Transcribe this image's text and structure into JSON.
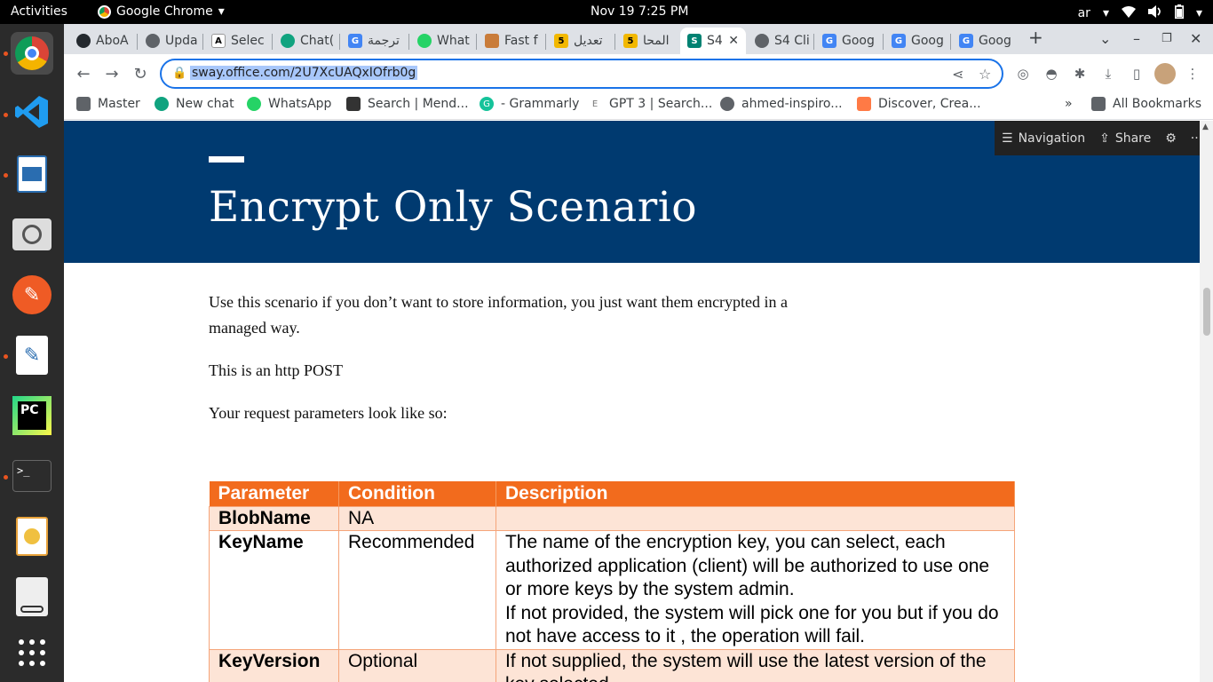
{
  "topbar": {
    "activities": "Activities",
    "app_name": "Google Chrome",
    "datetime": "Nov 19  7:25 PM",
    "lang": "ar",
    "tray_icons": [
      "wifi-icon",
      "volume-icon",
      "battery-icon",
      "power-menu-icon"
    ]
  },
  "dock": {
    "apps": [
      "chrome",
      "vscode",
      "impress",
      "image-viewer",
      "postman",
      "text-editor",
      "pycharm",
      "terminal",
      "draw",
      "document-viewer",
      "app-grid"
    ]
  },
  "tabs": [
    {
      "title": "AboA",
      "icon": "github-icon"
    },
    {
      "title": "Upda",
      "icon": "globe-icon"
    },
    {
      "title": "Selec",
      "icon": "a-icon"
    },
    {
      "title": "Chat(",
      "icon": "openai-icon"
    },
    {
      "title": "ترجمة",
      "icon": "translate-icon"
    },
    {
      "title": "What",
      "icon": "whatsapp-icon"
    },
    {
      "title": "Fast f",
      "icon": "market-icon"
    },
    {
      "title": "تعديل",
      "icon": "five-icon"
    },
    {
      "title": "المحا",
      "icon": "five-icon"
    },
    {
      "title": "S4",
      "icon": "sway-icon",
      "active": true
    },
    {
      "title": "S4 Cli",
      "icon": "globe-icon"
    },
    {
      "title": "Goog",
      "icon": "translate-icon"
    },
    {
      "title": "Goog",
      "icon": "translate-icon"
    },
    {
      "title": "Goog",
      "icon": "translate-icon"
    }
  ],
  "omnibox": {
    "url": "sway.office.com/2U7XcUAQxIOfrb0g"
  },
  "bookmarks": [
    {
      "label": "Master",
      "icon": "folder-icon"
    },
    {
      "label": "New chat",
      "icon": "openai-icon"
    },
    {
      "label": "WhatsApp",
      "icon": "whatsapp-icon"
    },
    {
      "label": "Search | Mend...",
      "icon": "mendeley-icon"
    },
    {
      "label": "- Grammarly",
      "icon": "grammarly-icon"
    },
    {
      "label": "GPT 3 | Search...",
      "icon": "e-icon"
    },
    {
      "label": "ahmed-inspiro...",
      "icon": "globe-icon"
    },
    {
      "label": "Discover, Crea...",
      "icon": "layers-icon"
    }
  ],
  "bookmarks_overflow": "»",
  "all_bookmarks": "All Bookmarks",
  "sway": {
    "navigation": "Navigation",
    "share": "Share",
    "more": "···"
  },
  "content": {
    "title": "Encrypt Only Scenario",
    "para1": "Use this scenario if you don’t want to store information, you just want them encrypted in a managed way.",
    "para2": "This is an http POST",
    "para3": "Your request parameters look like so:"
  },
  "table": {
    "headers": [
      "Parameter",
      "Condition",
      "Description"
    ],
    "rows": [
      {
        "param": "BlobName",
        "cond": "NA",
        "desc": ""
      },
      {
        "param": "KeyName",
        "cond": "Recommended",
        "desc": "The name of the encryption key, you can select, each authorized application (client) will be authorized to use one or more keys by the system admin.",
        "desc2": "If not provided, the system will pick one for you but if you do not have access to it , the operation will fail."
      },
      {
        "param": "KeyVersion",
        "cond": "Optional",
        "desc": "If not supplied, the system will use the latest version of the key selected."
      }
    ]
  }
}
